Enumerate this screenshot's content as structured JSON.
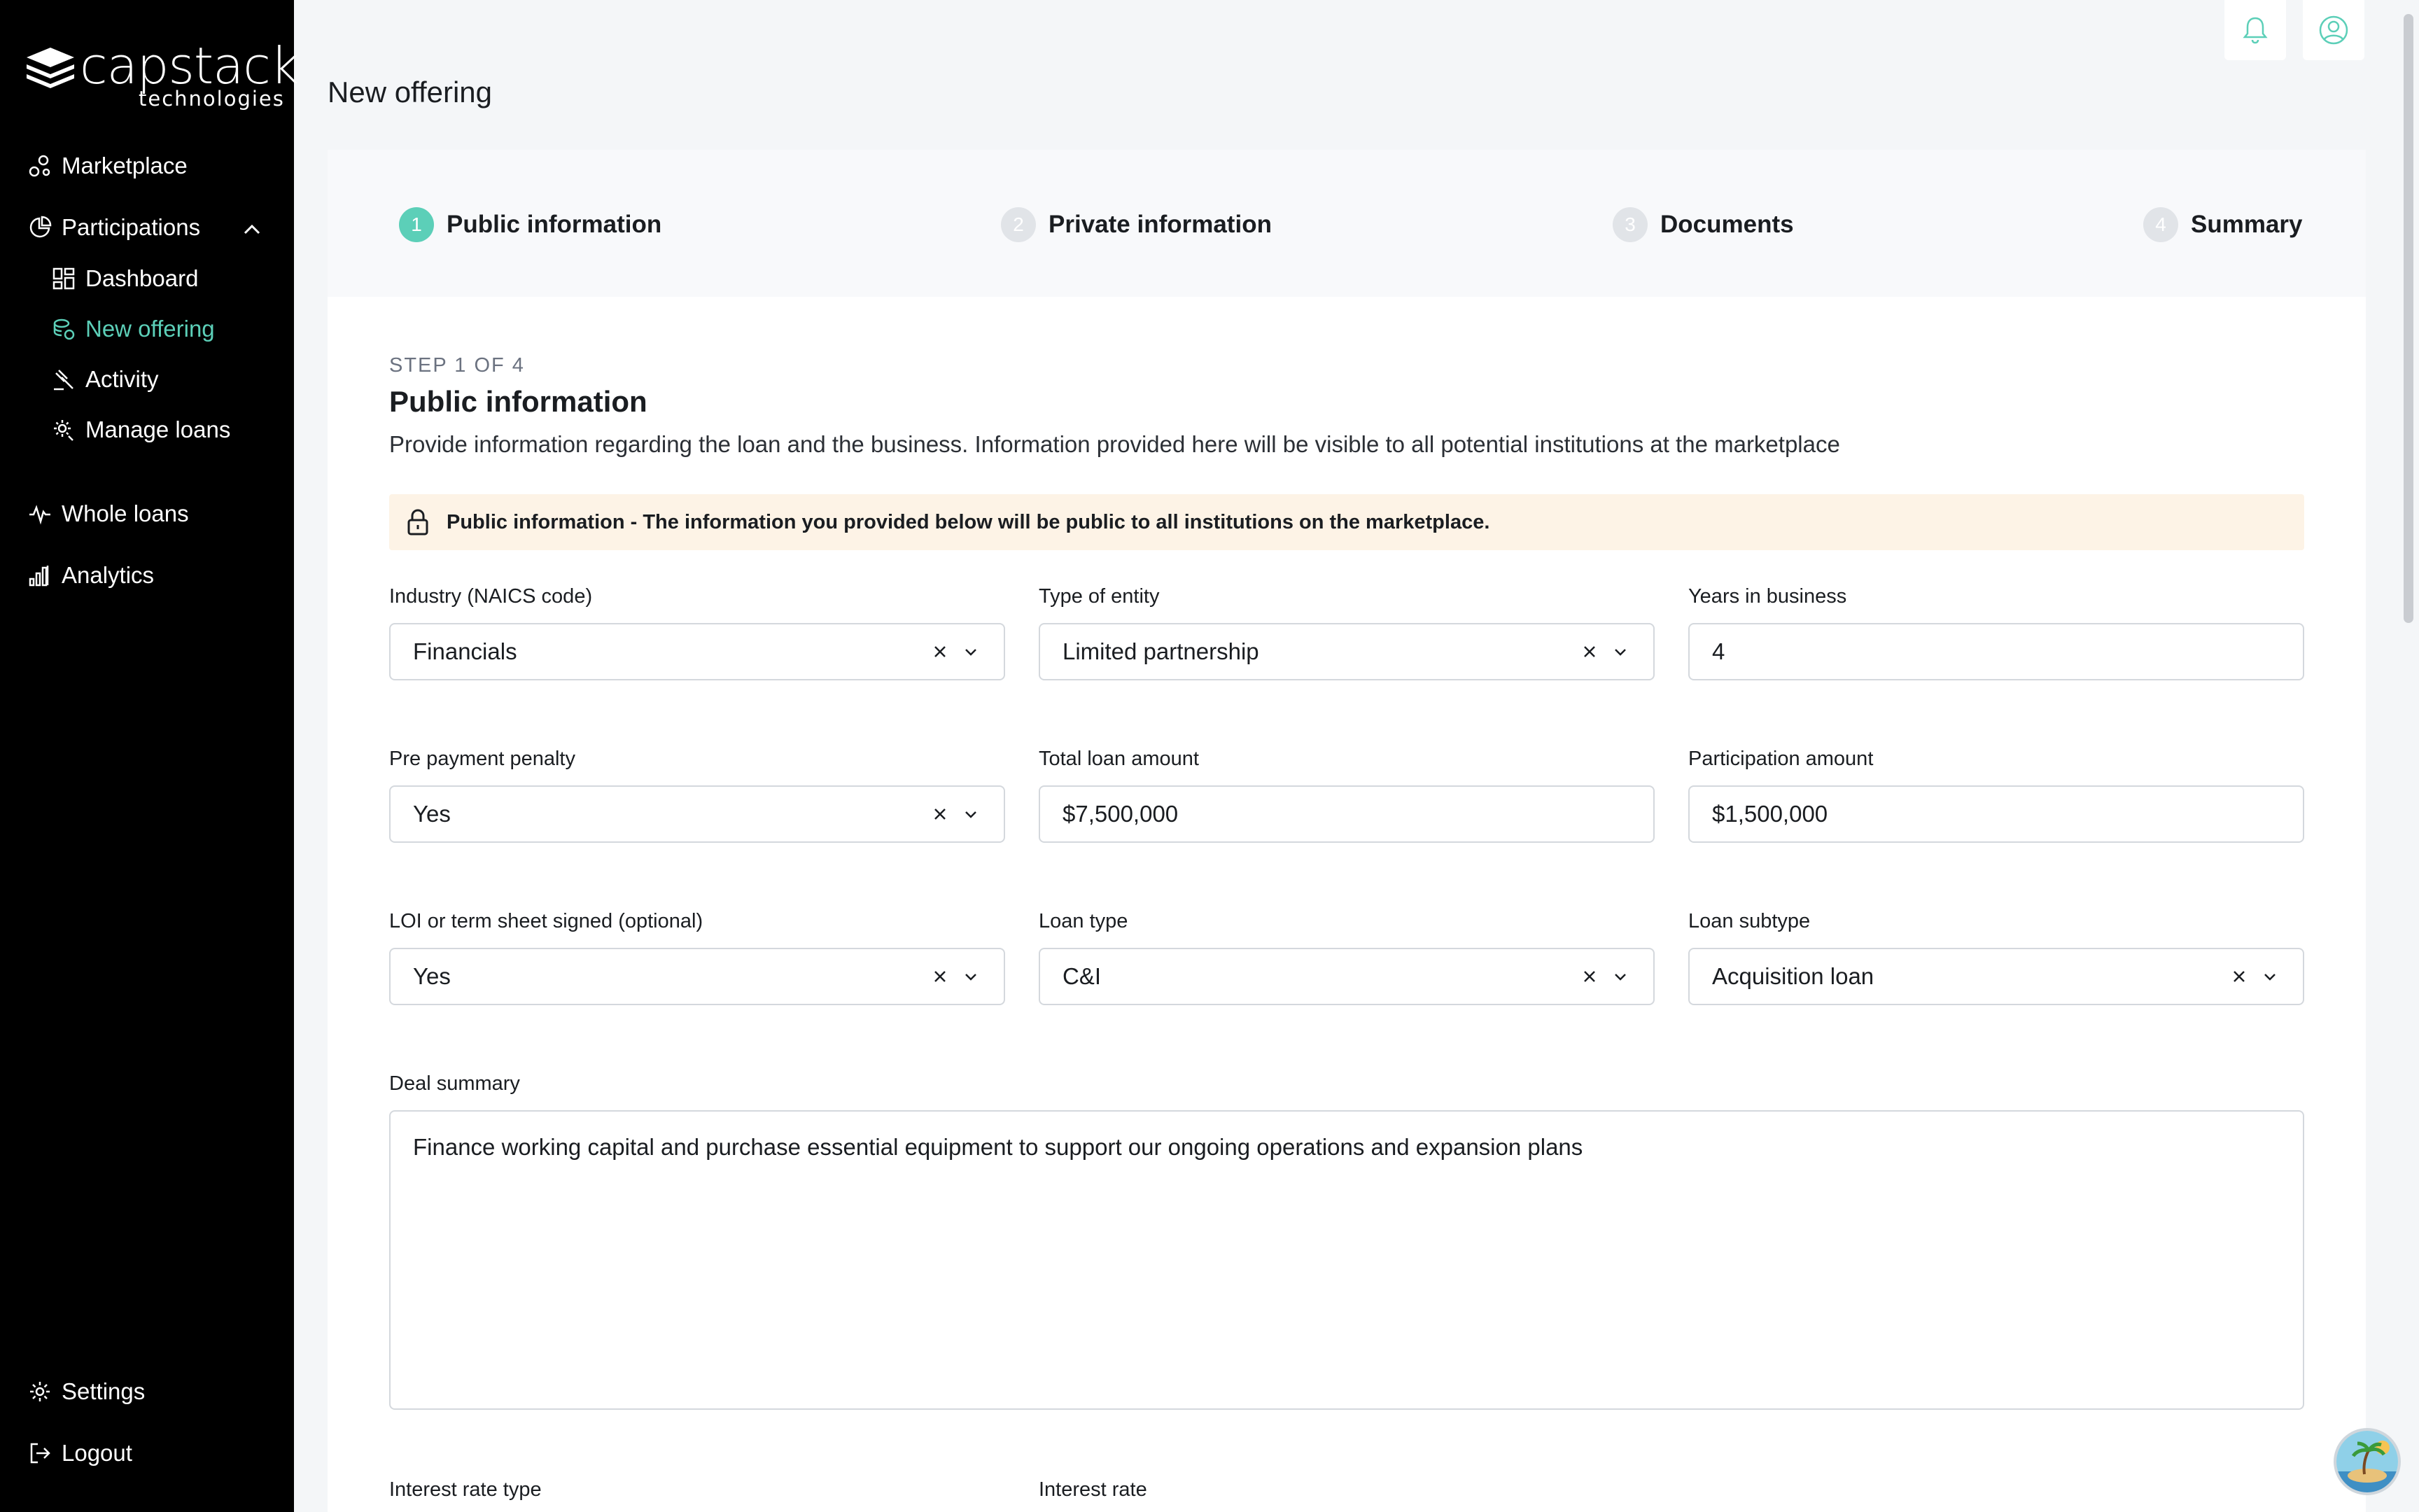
{
  "brand": {
    "name": "capstack",
    "subtitle": "technologies"
  },
  "sidebar": {
    "items": [
      {
        "label": "Marketplace",
        "icon": "marketplace-icon"
      },
      {
        "label": "Participations",
        "icon": "pie-chart-icon"
      },
      {
        "label": "Dashboard",
        "icon": "dashboard-icon"
      },
      {
        "label": "New offering",
        "icon": "new-offering-icon"
      },
      {
        "label": "Activity",
        "icon": "gavel-icon"
      },
      {
        "label": "Manage loans",
        "icon": "manage-gear-icon"
      },
      {
        "label": "Whole loans",
        "icon": "pulse-icon"
      },
      {
        "label": "Analytics",
        "icon": "bar-chart-icon"
      }
    ],
    "footer": [
      {
        "label": "Settings",
        "icon": "gear-icon"
      },
      {
        "label": "Logout",
        "icon": "logout-icon"
      }
    ]
  },
  "page": {
    "title": "New offering"
  },
  "stepper": {
    "steps": [
      {
        "num": "1",
        "label": "Public information"
      },
      {
        "num": "2",
        "label": "Private information"
      },
      {
        "num": "3",
        "label": "Documents"
      },
      {
        "num": "4",
        "label": "Summary"
      }
    ]
  },
  "form": {
    "step_count": "STEP 1 OF 4",
    "title": "Public information",
    "description": "Provide information regarding the loan and the business. Information provided here will be visible to all potential institutions at the marketplace",
    "notice": "Public information - The information you provided below will be public to all institutions on the marketplace.",
    "fields": {
      "industry": {
        "label": "Industry (NAICS code)",
        "value": "Financials"
      },
      "entity": {
        "label": "Type of entity",
        "value": "Limited partnership"
      },
      "years": {
        "label": "Years in business",
        "value": "4"
      },
      "prepayment": {
        "label": "Pre payment penalty",
        "value": "Yes"
      },
      "total_loan": {
        "label": "Total loan amount",
        "value": "$7,500,000"
      },
      "participation": {
        "label": "Participation amount",
        "value": "$1,500,000"
      },
      "loi": {
        "label": "LOI or term sheet signed (optional)",
        "value": "Yes"
      },
      "loan_type": {
        "label": "Loan type",
        "value": "C&I"
      },
      "loan_subtype": {
        "label": "Loan subtype",
        "value": "Acquisition loan"
      },
      "deal_summary": {
        "label": "Deal summary",
        "value": "Finance working capital and purchase essential equipment to support our ongoing operations and expansion plans"
      },
      "interest_rate_type": {
        "label": "Interest rate type"
      },
      "interest_rate": {
        "label": "Interest rate"
      }
    }
  },
  "colors": {
    "accent": "#5ccfb8",
    "sidebar_bg": "#000000",
    "notice_bg": "#fdf3e6"
  }
}
